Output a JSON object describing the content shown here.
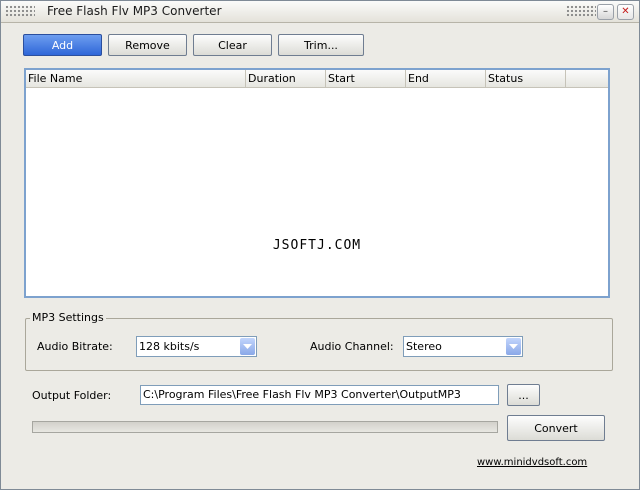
{
  "window": {
    "title": "Free Flash Flv MP3 Converter",
    "minimize_glyph": "–",
    "close_glyph": "✕"
  },
  "toolbar": {
    "add_label": "Add",
    "remove_label": "Remove",
    "clear_label": "Clear",
    "trim_label": "Trim..."
  },
  "file_list": {
    "columns": [
      "File Name",
      "Duration",
      "Start",
      "End",
      "Status"
    ],
    "watermark": "JSOFTJ.COM"
  },
  "mp3_settings": {
    "title": "MP3 Settings",
    "bitrate_label": "Audio Bitrate:",
    "bitrate_value": "128 kbits/s",
    "channel_label": "Audio Channel:",
    "channel_value": "Stereo"
  },
  "output": {
    "folder_label": "Output Folder:",
    "folder_value": "C:\\Program Files\\Free Flash Flv MP3 Converter\\OutputMP3",
    "browse_label": "...",
    "progress": 0
  },
  "actions": {
    "convert_label": "Convert"
  },
  "footer": {
    "website": "www.minidvdsoft.com"
  },
  "colors": {
    "accent": "#2e66d8",
    "list_border": "#7da2ce",
    "window_bg": "#ecebe6"
  }
}
